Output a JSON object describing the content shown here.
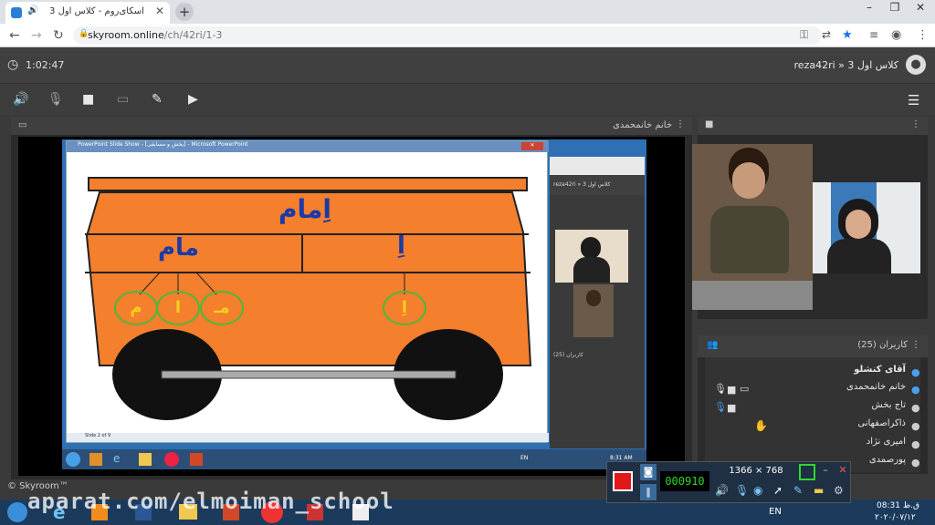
{
  "browser": {
    "tab_title": "اسکای‌روم - کلاس اول 3",
    "new_tab": "+",
    "url_host": "skyroom.online",
    "url_path": "/ch/42ri/1-3"
  },
  "header": {
    "timer": "1:02:47",
    "room_title": "reza42ri » کلاس اول 3"
  },
  "stage": {
    "presenter": "خانم خانمحمدی",
    "ppt_title": "PowerPoint Slide Show - [یخش و مسابقی] - Microsoft PowerPoint",
    "ppt_status": "Slide 2 of 9",
    "word_top": "اِمام",
    "word_left": "مام",
    "letters": [
      "م",
      "ا",
      "مـ"
    ],
    "letter_right": "اِ",
    "inner_title": "reza42ri » کلاس اول 3",
    "inner_users": "کاربران (25)",
    "inner_clock": "8:31 AM",
    "taskbar_lang": "EN"
  },
  "users": {
    "title": "کاربران (25)",
    "list": [
      "آقای کنشلو",
      "خانم خانمحمدی",
      "تاج بخش",
      "ذاکراصفهانی",
      "امیری نژاد",
      "پورصمدی"
    ]
  },
  "footer": {
    "copyright": "© Skyroom™"
  },
  "recorder": {
    "counter": "000910",
    "resolution": "1366 × 768"
  },
  "taskbar": {
    "lang": "EN",
    "time": "08:31 ق.ظ",
    "date": "۲۰۲۰/۰۷/۱۲"
  },
  "watermark": "aparat.com/elmoiman_school",
  "colors": {
    "cart": "#f47f2c",
    "accent": "#f5d01c",
    "ring": "#4db83a",
    "word": "#1b3aa8"
  }
}
